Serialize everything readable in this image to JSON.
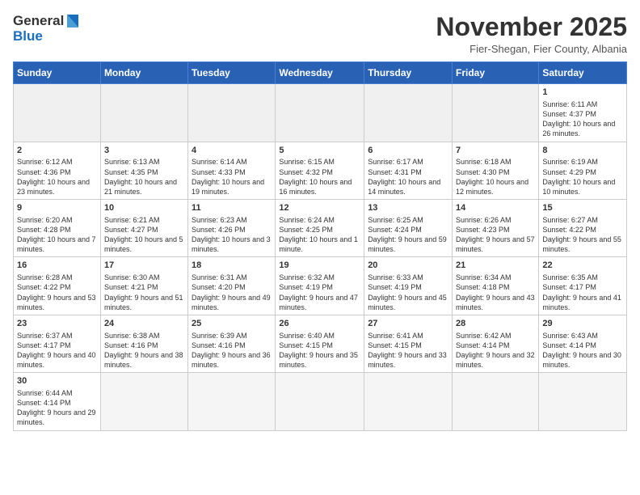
{
  "header": {
    "logo_general": "General",
    "logo_blue": "Blue",
    "month_title": "November 2025",
    "subtitle": "Fier-Shegan, Fier County, Albania"
  },
  "days_of_week": [
    "Sunday",
    "Monday",
    "Tuesday",
    "Wednesday",
    "Thursday",
    "Friday",
    "Saturday"
  ],
  "weeks": [
    [
      {
        "day": "",
        "info": ""
      },
      {
        "day": "",
        "info": ""
      },
      {
        "day": "",
        "info": ""
      },
      {
        "day": "",
        "info": ""
      },
      {
        "day": "",
        "info": ""
      },
      {
        "day": "",
        "info": ""
      },
      {
        "day": "1",
        "info": "Sunrise: 6:11 AM\nSunset: 4:37 PM\nDaylight: 10 hours and 26 minutes."
      }
    ],
    [
      {
        "day": "2",
        "info": "Sunrise: 6:12 AM\nSunset: 4:36 PM\nDaylight: 10 hours and 23 minutes."
      },
      {
        "day": "3",
        "info": "Sunrise: 6:13 AM\nSunset: 4:35 PM\nDaylight: 10 hours and 21 minutes."
      },
      {
        "day": "4",
        "info": "Sunrise: 6:14 AM\nSunset: 4:33 PM\nDaylight: 10 hours and 19 minutes."
      },
      {
        "day": "5",
        "info": "Sunrise: 6:15 AM\nSunset: 4:32 PM\nDaylight: 10 hours and 16 minutes."
      },
      {
        "day": "6",
        "info": "Sunrise: 6:17 AM\nSunset: 4:31 PM\nDaylight: 10 hours and 14 minutes."
      },
      {
        "day": "7",
        "info": "Sunrise: 6:18 AM\nSunset: 4:30 PM\nDaylight: 10 hours and 12 minutes."
      },
      {
        "day": "8",
        "info": "Sunrise: 6:19 AM\nSunset: 4:29 PM\nDaylight: 10 hours and 10 minutes."
      }
    ],
    [
      {
        "day": "9",
        "info": "Sunrise: 6:20 AM\nSunset: 4:28 PM\nDaylight: 10 hours and 7 minutes."
      },
      {
        "day": "10",
        "info": "Sunrise: 6:21 AM\nSunset: 4:27 PM\nDaylight: 10 hours and 5 minutes."
      },
      {
        "day": "11",
        "info": "Sunrise: 6:23 AM\nSunset: 4:26 PM\nDaylight: 10 hours and 3 minutes."
      },
      {
        "day": "12",
        "info": "Sunrise: 6:24 AM\nSunset: 4:25 PM\nDaylight: 10 hours and 1 minute."
      },
      {
        "day": "13",
        "info": "Sunrise: 6:25 AM\nSunset: 4:24 PM\nDaylight: 9 hours and 59 minutes."
      },
      {
        "day": "14",
        "info": "Sunrise: 6:26 AM\nSunset: 4:23 PM\nDaylight: 9 hours and 57 minutes."
      },
      {
        "day": "15",
        "info": "Sunrise: 6:27 AM\nSunset: 4:22 PM\nDaylight: 9 hours and 55 minutes."
      }
    ],
    [
      {
        "day": "16",
        "info": "Sunrise: 6:28 AM\nSunset: 4:22 PM\nDaylight: 9 hours and 53 minutes."
      },
      {
        "day": "17",
        "info": "Sunrise: 6:30 AM\nSunset: 4:21 PM\nDaylight: 9 hours and 51 minutes."
      },
      {
        "day": "18",
        "info": "Sunrise: 6:31 AM\nSunset: 4:20 PM\nDaylight: 9 hours and 49 minutes."
      },
      {
        "day": "19",
        "info": "Sunrise: 6:32 AM\nSunset: 4:19 PM\nDaylight: 9 hours and 47 minutes."
      },
      {
        "day": "20",
        "info": "Sunrise: 6:33 AM\nSunset: 4:19 PM\nDaylight: 9 hours and 45 minutes."
      },
      {
        "day": "21",
        "info": "Sunrise: 6:34 AM\nSunset: 4:18 PM\nDaylight: 9 hours and 43 minutes."
      },
      {
        "day": "22",
        "info": "Sunrise: 6:35 AM\nSunset: 4:17 PM\nDaylight: 9 hours and 41 minutes."
      }
    ],
    [
      {
        "day": "23",
        "info": "Sunrise: 6:37 AM\nSunset: 4:17 PM\nDaylight: 9 hours and 40 minutes."
      },
      {
        "day": "24",
        "info": "Sunrise: 6:38 AM\nSunset: 4:16 PM\nDaylight: 9 hours and 38 minutes."
      },
      {
        "day": "25",
        "info": "Sunrise: 6:39 AM\nSunset: 4:16 PM\nDaylight: 9 hours and 36 minutes."
      },
      {
        "day": "26",
        "info": "Sunrise: 6:40 AM\nSunset: 4:15 PM\nDaylight: 9 hours and 35 minutes."
      },
      {
        "day": "27",
        "info": "Sunrise: 6:41 AM\nSunset: 4:15 PM\nDaylight: 9 hours and 33 minutes."
      },
      {
        "day": "28",
        "info": "Sunrise: 6:42 AM\nSunset: 4:14 PM\nDaylight: 9 hours and 32 minutes."
      },
      {
        "day": "29",
        "info": "Sunrise: 6:43 AM\nSunset: 4:14 PM\nDaylight: 9 hours and 30 minutes."
      }
    ],
    [
      {
        "day": "30",
        "info": "Sunrise: 6:44 AM\nSunset: 4:14 PM\nDaylight: 9 hours and 29 minutes."
      },
      {
        "day": "",
        "info": ""
      },
      {
        "day": "",
        "info": ""
      },
      {
        "day": "",
        "info": ""
      },
      {
        "day": "",
        "info": ""
      },
      {
        "day": "",
        "info": ""
      },
      {
        "day": "",
        "info": ""
      }
    ]
  ]
}
